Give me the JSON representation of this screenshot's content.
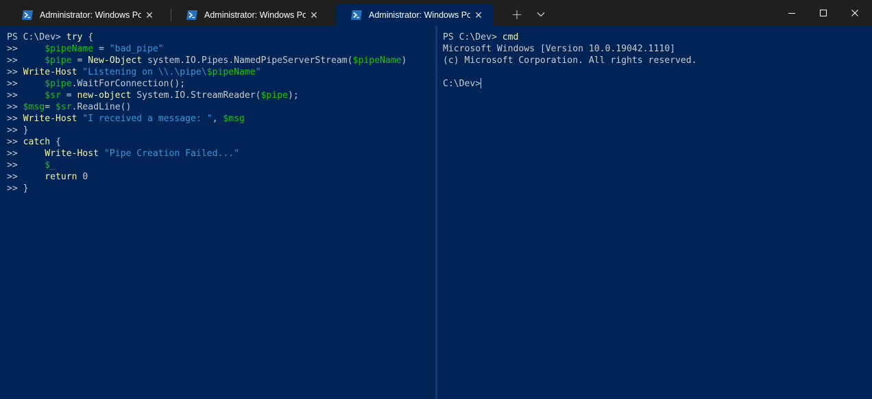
{
  "tabs": [
    {
      "title": "Administrator: Windows PowerShell",
      "active": false
    },
    {
      "title": "Administrator: Windows PowerShell",
      "active": false
    },
    {
      "title": "Administrator: Windows PowerShell",
      "active": true
    }
  ],
  "icons": {
    "tab": "powershell-icon",
    "new_tab": "plus-icon",
    "dropdown": "chevron-down-icon",
    "close_tab": "close-icon",
    "minimize": "minimize-icon",
    "maximize": "maximize-icon",
    "close_window": "close-icon"
  },
  "glyphs": {
    "new_tab": "+",
    "close_tab": "✕"
  },
  "colors": {
    "titlebar": "#1f1f1f",
    "terminal_bg": "#012456",
    "foreground": "#cccccc",
    "command": "#f9f1a5",
    "variable": "#16c60c",
    "string": "#3b78ff"
  },
  "left_pane": {
    "lines": [
      [
        {
          "t": "PS C:\\Dev> ",
          "c": "w"
        },
        {
          "t": "try",
          "c": "y"
        },
        {
          "t": " {",
          "c": "w"
        }
      ],
      [
        {
          "t": ">>     ",
          "c": "w"
        },
        {
          "t": "$pipeName",
          "c": "g"
        },
        {
          "t": " = ",
          "c": "w"
        },
        {
          "t": "\"bad_pipe\"",
          "c": "k"
        }
      ],
      [
        {
          "t": ">>     ",
          "c": "w"
        },
        {
          "t": "$pipe",
          "c": "g"
        },
        {
          "t": " = ",
          "c": "w"
        },
        {
          "t": "New-Object",
          "c": "y"
        },
        {
          "t": " system.IO.Pipes.NamedPipeServerStream(",
          "c": "w"
        },
        {
          "t": "$pipeName",
          "c": "g"
        },
        {
          "t": ")",
          "c": "w"
        }
      ],
      [
        {
          "t": ">> ",
          "c": "w"
        },
        {
          "t": "Write-Host",
          "c": "y"
        },
        {
          "t": " ",
          "c": "w"
        },
        {
          "t": "\"Listening on \\\\.\\pipe\\",
          "c": "k"
        },
        {
          "t": "$pipeName",
          "c": "g"
        },
        {
          "t": "\"",
          "c": "k"
        }
      ],
      [
        {
          "t": ">>     ",
          "c": "w"
        },
        {
          "t": "$pipe",
          "c": "g"
        },
        {
          "t": ".WaitForConnection();",
          "c": "w"
        }
      ],
      [
        {
          "t": ">>     ",
          "c": "w"
        },
        {
          "t": "$sr",
          "c": "g"
        },
        {
          "t": " = ",
          "c": "w"
        },
        {
          "t": "new-object",
          "c": "y"
        },
        {
          "t": " System.IO.StreamReader(",
          "c": "w"
        },
        {
          "t": "$pipe",
          "c": "g"
        },
        {
          "t": ");",
          "c": "w"
        }
      ],
      [
        {
          "t": ">> ",
          "c": "w"
        },
        {
          "t": "$msg",
          "c": "g"
        },
        {
          "t": "= ",
          "c": "w"
        },
        {
          "t": "$sr",
          "c": "g"
        },
        {
          "t": ".ReadLine()",
          "c": "w"
        }
      ],
      [
        {
          "t": ">> ",
          "c": "w"
        },
        {
          "t": "Write-Host",
          "c": "y"
        },
        {
          "t": " ",
          "c": "w"
        },
        {
          "t": "\"I received a message: \"",
          "c": "k"
        },
        {
          "t": ", ",
          "c": "w"
        },
        {
          "t": "$msg",
          "c": "g"
        }
      ],
      [
        {
          "t": ">> }",
          "c": "w"
        }
      ],
      [
        {
          "t": ">> ",
          "c": "w"
        },
        {
          "t": "catch",
          "c": "y"
        },
        {
          "t": " {",
          "c": "w"
        }
      ],
      [
        {
          "t": ">>     ",
          "c": "w"
        },
        {
          "t": "Write-Host",
          "c": "y"
        },
        {
          "t": " ",
          "c": "w"
        },
        {
          "t": "\"Pipe Creation Failed...\"",
          "c": "k"
        }
      ],
      [
        {
          "t": ">>     ",
          "c": "w"
        },
        {
          "t": "$_",
          "c": "g"
        }
      ],
      [
        {
          "t": ">>     ",
          "c": "w"
        },
        {
          "t": "return",
          "c": "y"
        },
        {
          "t": " 0",
          "c": "w"
        }
      ],
      [
        {
          "t": ">> }",
          "c": "w"
        }
      ]
    ]
  },
  "right_pane": {
    "lines": [
      [
        {
          "t": "PS C:\\Dev> ",
          "c": "w"
        },
        {
          "t": "cmd",
          "c": "y"
        }
      ],
      [
        {
          "t": "Microsoft Windows [Version 10.0.19042.1110]",
          "c": "w"
        }
      ],
      [
        {
          "t": "(c) Microsoft Corporation. All rights reserved.",
          "c": "w"
        }
      ],
      [
        {
          "t": "",
          "c": "w"
        }
      ],
      [
        {
          "t": "C:\\Dev>",
          "c": "w"
        }
      ]
    ],
    "cursor_line": 4
  }
}
